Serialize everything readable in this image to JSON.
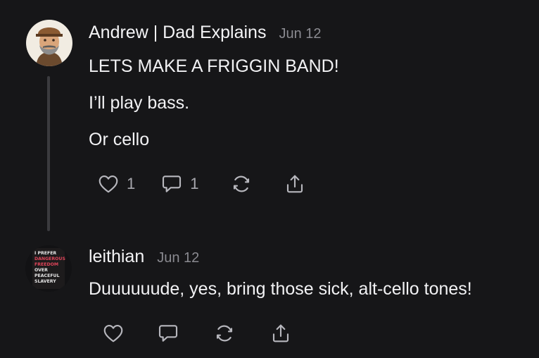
{
  "comments": [
    {
      "author": "Andrew | Dad Explains",
      "date": "Jun 12",
      "paragraphs": [
        "LETS MAKE A FRIGGIN BAND!",
        "I’ll play bass.",
        "Or cello"
      ],
      "like_count": "1",
      "reply_count": "1",
      "icons": [
        "heart-icon",
        "comment-bubble-icon",
        "restack-icon",
        "share-icon"
      ]
    },
    {
      "author": "leithian",
      "date": "Jun 12",
      "paragraphs": [
        "Duuuuuude, yes, bring those sick, alt-cello tones!"
      ],
      "avatar_text": [
        "I PREFER",
        "DANGEROUS",
        "FREEDOM",
        "OVER",
        "PEACEFUL",
        "SLAVERY"
      ],
      "icons": [
        "heart-icon",
        "comment-bubble-icon",
        "restack-icon",
        "share-icon"
      ]
    }
  ],
  "colors": {
    "background": "#161618",
    "text": "#f2f2f4",
    "muted": "#8a8a90",
    "icon": "#b7b7bd",
    "thread_line": "#3b3b3f",
    "avatar_accent": "#e0455a"
  }
}
